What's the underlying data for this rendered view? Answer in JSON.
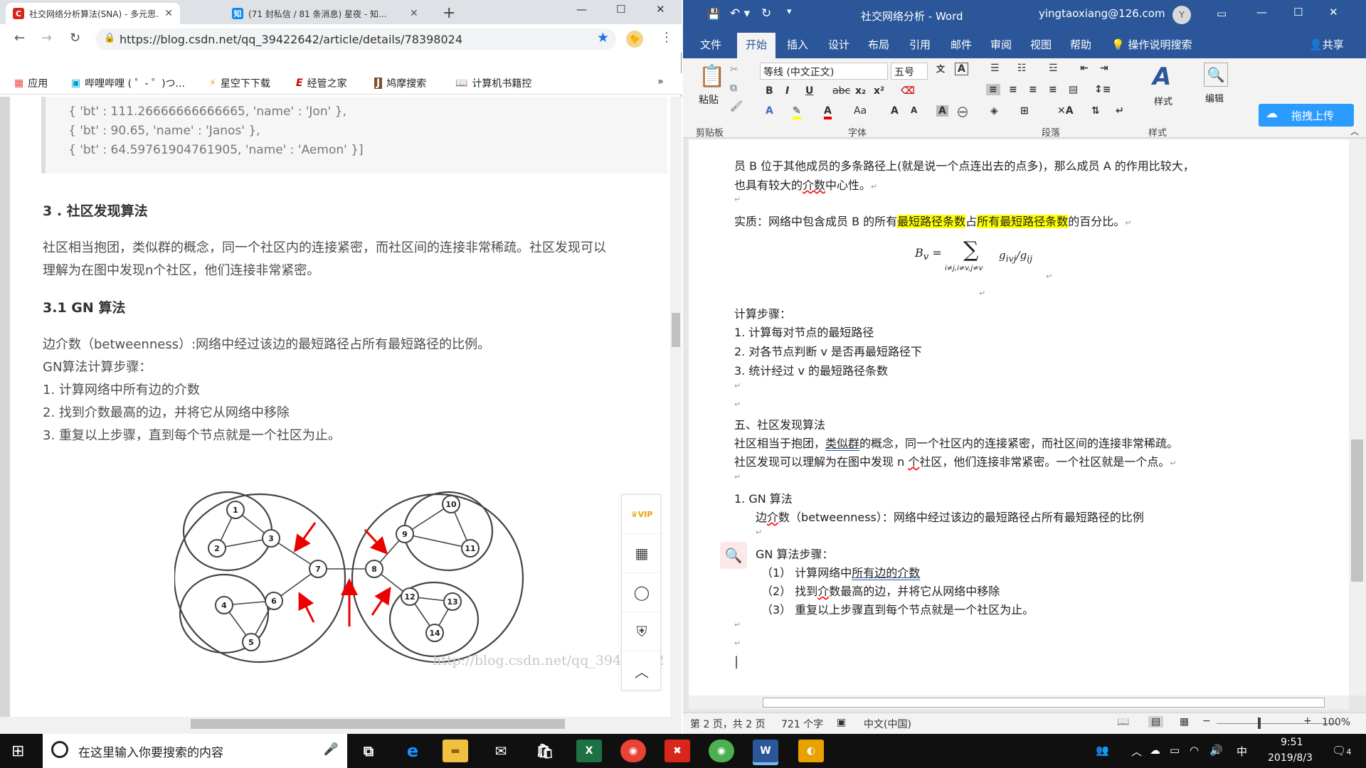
{
  "chrome": {
    "tabs": [
      {
        "title": "社交网络分析算法(SNA) - 多元思...",
        "icon": "C",
        "color": "#d9261c"
      },
      {
        "title": "(71 封私信 / 81 条消息) 星夜 - 知...",
        "icon": "知",
        "color": "#0f88eb"
      }
    ],
    "url": "https://blog.csdn.net/qq_39422642/article/details/78398024",
    "bookmarks": [
      "应用",
      "哔哩哔哩 ( ゜- ゜)つ...",
      "星空下下载",
      "经管之家",
      "鸠摩搜索",
      "计算机书籍控"
    ],
    "bm_more": "»",
    "code_lines": [
      "{  'bt' : 111.26666666666665,  'name' :  'Jon' },",
      "{  'bt' : 90.65,  'name' :  'Janos' },",
      "{  'bt' : 64.59761904761905,  'name' :  'Aemon' }]"
    ],
    "h_community": "3 . 社区发现算法",
    "p_community_1": "社区相当抱团，类似群的概念，同一个社区内的连接紧密，而社区间的连接非常稀疏。社区发现可以",
    "p_community_2": "理解为在图中发现n个社区，他们连接非常紧密。",
    "h_gn": "3.1 GN 算法",
    "gn_lines": [
      "边介数（betweenness）:网络中经过该边的最短路径占所有最短路径的比例。",
      "GN算法计算步骤：",
      "1. 计算网络中所有边的介数",
      "2. 找到介数最高的边，并将它从网络中移除",
      "3. 重复以上步骤，直到每个节点就是一个社区为止。"
    ],
    "watermark": "http://blog.csdn.net/qq_39422642",
    "graph_nodes": [
      "1",
      "2",
      "3",
      "4",
      "5",
      "6",
      "7",
      "8",
      "9",
      "10",
      "11",
      "12",
      "13",
      "14"
    ],
    "vip_label": "VIP"
  },
  "word": {
    "title": "社交网络分析  -  Word",
    "account": "yingtaoxiang@126.com",
    "account_initial": "Y",
    "tabs": [
      "文件",
      "开始",
      "插入",
      "设计",
      "布局",
      "引用",
      "邮件",
      "审阅",
      "视图",
      "帮助"
    ],
    "tell_me": "操作说明搜索",
    "share": "共享",
    "font_name": "等线 (中文正文)",
    "font_size": "五号",
    "groups": [
      "剪贴板",
      "字体",
      "段落",
      "样式",
      "编辑"
    ],
    "paste": "粘贴",
    "style_label": "样式",
    "edit_label": "编辑",
    "upload": "拖拽上传",
    "lines": {
      "l1": "员 B 位于其他成员的多条路径上(就是说一个点连出去的点多)，那么成员 A 的作用比较大，",
      "l2a": "也具有较大的",
      "l2b": "介数",
      "l2c": "中心性。",
      "l3a": "实质：网络中包含成员 B 的所有",
      "l3b": "最短路径条数",
      "l3c": "占",
      "l3d": "所有最短路径条数",
      "l3e": "的百分比。",
      "formula_lhs": "B",
      "formula_sub": "v",
      "formula_sum_sub": "i≠j,i≠v,j≠v",
      "formula_rhs": "g",
      "steps_title": "计算步骤：",
      "steps": [
        "1.   计算每对节点的最短路径",
        "2.   对各节点判断 v 是否再最短路径下",
        "3.   统计经过 v 的最短路径条数"
      ],
      "sec5": "五、社区发现算法",
      "c1a": "社区相当于抱团，",
      "c1b": "类似群",
      "c1c": "的概念，同一个社区内的连接紧密，而社区间的连接非常稀疏。",
      "c2a": "社区发现可以理解为在图中发现 n ",
      "c2b": "个",
      "c2c": "社区，他们连接非常紧密。一个社区就是一个点。",
      "gn": "1.   GN 算法",
      "bt_a": "边",
      "bt_b": "介",
      "bt_c": "数（betweenness）：网络中经过该边的最短路径占所有最短路径的比例",
      "gn_steps": "GN 算法步骤：",
      "s1a": "（1）     计算网络中",
      "s1b": "所有边的介数",
      "s2a": "（2）     找到",
      "s2b": "介",
      "s2c": "数最高的边，并将它从网络中移除",
      "s3": "（3）     重复以上步骤直到每个节点就是一个社区为止。"
    },
    "status": {
      "page": "第 2 页，共 2 页",
      "words": "721 个字",
      "lang": "中文(中国)",
      "zoom": "100%"
    }
  },
  "taskbar": {
    "search_placeholder": "在这里输入你要搜索的内容",
    "time": "9:51",
    "date": "2019/8/3",
    "ime": "中",
    "notif": "4"
  }
}
